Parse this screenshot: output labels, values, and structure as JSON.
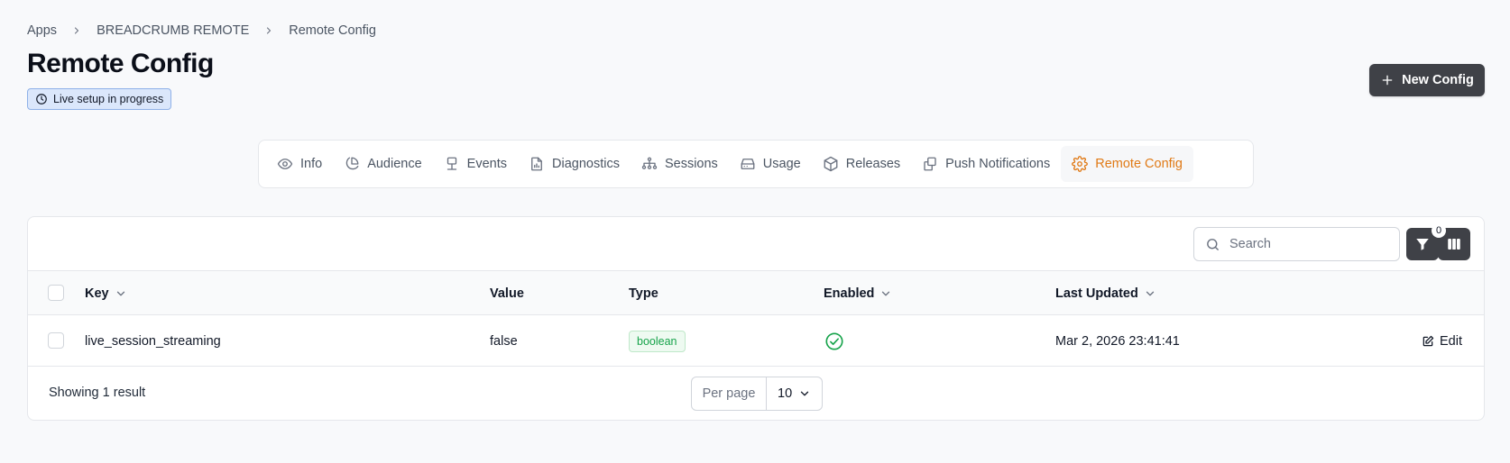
{
  "breadcrumb": {
    "items": [
      "Apps",
      "BREADCRUMB REMOTE",
      "Remote Config"
    ]
  },
  "page": {
    "title": "Remote Config",
    "live_badge": "Live setup in progress",
    "new_button": "New Config"
  },
  "tabs": [
    {
      "label": "Info",
      "icon": "eye-icon",
      "active": false
    },
    {
      "label": "Audience",
      "icon": "pie-chart-icon",
      "active": false
    },
    {
      "label": "Events",
      "icon": "network-icon",
      "active": false
    },
    {
      "label": "Diagnostics",
      "icon": "file-chart-icon",
      "active": false
    },
    {
      "label": "Sessions",
      "icon": "workflow-icon",
      "active": false
    },
    {
      "label": "Usage",
      "icon": "hard-drive-icon",
      "active": false
    },
    {
      "label": "Releases",
      "icon": "package-icon",
      "active": false
    },
    {
      "label": "Push Notifications",
      "icon": "copy-icon",
      "active": false
    },
    {
      "label": "Remote Config",
      "icon": "gear-icon",
      "active": true
    }
  ],
  "toolbar": {
    "search_placeholder": "Search",
    "filter_count": "0"
  },
  "table": {
    "columns": {
      "key": "Key",
      "value": "Value",
      "type": "Type",
      "enabled": "Enabled",
      "last_updated": "Last Updated"
    },
    "rows": [
      {
        "key": "live_session_streaming",
        "value": "false",
        "type": "boolean",
        "enabled": true,
        "last_updated": "Mar 2, 2026 23:41:41",
        "action": "Edit"
      }
    ]
  },
  "footer": {
    "showing": "Showing 1 result",
    "per_page_label": "Per page",
    "per_page_value": "10"
  },
  "colors": {
    "accent": "#e07a16",
    "primary_button": "#3f4147",
    "success": "#16a34a",
    "badge_bg": "#dbe7fb"
  }
}
